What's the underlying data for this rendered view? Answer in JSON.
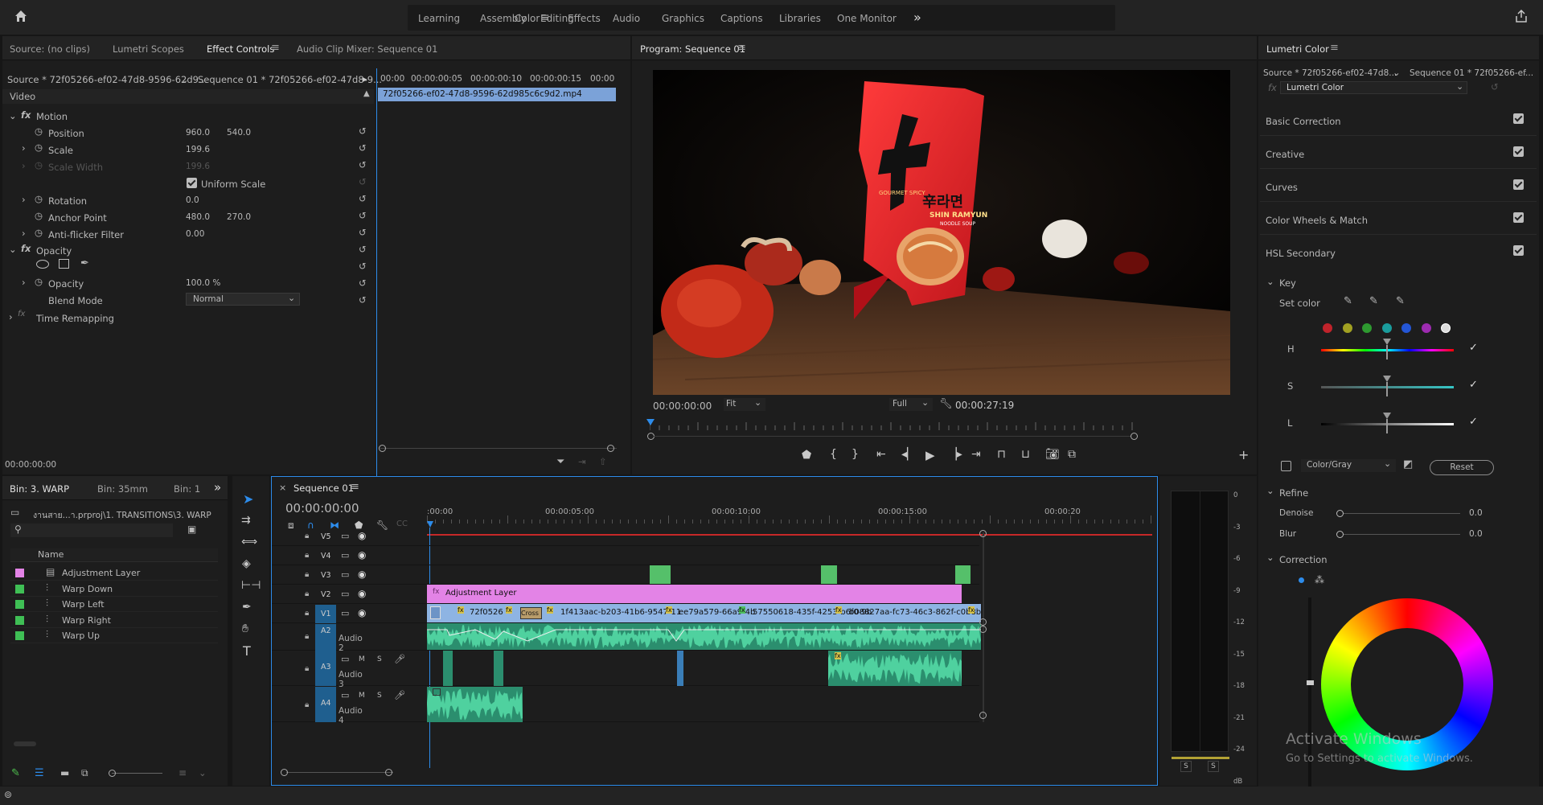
{
  "workspaces": {
    "items": [
      "Learning",
      "Assembly",
      "Editing",
      "Color",
      "Effects",
      "Audio",
      "Graphics",
      "Captions",
      "Libraries",
      "One Monitor"
    ],
    "active": "Color",
    "more": "»"
  },
  "ec": {
    "tabs": [
      "Source: (no clips)",
      "Lumetri Scopes",
      "Effect Controls",
      "Audio Clip Mixer: Sequence 01"
    ],
    "source_sel": "Source * 72f05266-ef02-47d8-9596-62d9...",
    "seq_sel": "Sequence 01 * 72f05266-ef02-47d8-9...",
    "ruler": [
      "00:00",
      "00:00:00:05",
      "00:00:00:10",
      "00:00:00:15",
      "00:00"
    ],
    "clip": "72f05266-ef02-47d8-9596-62d985c6c9d2.mp4",
    "video": "Video",
    "motion": "Motion",
    "position": "Position",
    "pos_x": "960.0",
    "pos_y": "540.0",
    "scale": "Scale",
    "scale_v": "199.6",
    "scale_width": "Scale Width",
    "scale_width_v": "199.6",
    "uniform": "Uniform Scale",
    "rotation": "Rotation",
    "rotation_v": "0.0",
    "anchor": "Anchor Point",
    "anchor_x": "480.0",
    "anchor_y": "270.0",
    "antiflicker": "Anti-flicker Filter",
    "antiflicker_v": "0.00",
    "opacity": "Opacity",
    "opacity_v": "100.0 %",
    "blend": "Blend Mode",
    "blend_v": "Normal",
    "time_remap": "Time Remapping",
    "timecode": "00:00:00:00"
  },
  "program": {
    "title": "Program: Sequence 01",
    "timecode": "00:00:00:00",
    "fit": "Fit",
    "full": "Full",
    "duration": "00:00:27:19",
    "pack": {
      "brand_ko": "辛라면",
      "brand": "SHIN RAMYUN",
      "noodle": "NOODLE SOUP",
      "spicy": "GOURMET SPICY"
    }
  },
  "lumetri": {
    "title": "Lumetri Color",
    "source_sel": "Source * 72f05266-ef02-47d8...",
    "seq_sel": "Sequence 01 * 72f05266-ef...",
    "effect": "Lumetri Color",
    "sections": [
      "Basic Correction",
      "Creative",
      "Curves",
      "Color Wheels & Match",
      "HSL Secondary"
    ],
    "key": "Key",
    "set_color": "Set color",
    "swatches": [
      "#c0232b",
      "#a2a122",
      "#2e9a30",
      "#1a9c9c",
      "#2456d6",
      "#9d2bb0",
      "#dcdcdc"
    ],
    "h": "H",
    "s": "S",
    "l": "L",
    "color_gray": "Color/Gray",
    "reset": "Reset",
    "refine": "Refine",
    "denoise": "Denoise",
    "denoise_v": "0.0",
    "blur": "Blur",
    "blur_v": "0.0",
    "correction": "Correction",
    "watermark1": "Activate Windows",
    "watermark2": "Go to Settings to activate Windows."
  },
  "project": {
    "tabs": [
      "Bin: 3. WARP",
      "Bin: 35mm",
      "Bin: 1"
    ],
    "path": "งานสาย...า.prproj\\1. TRANSITIONS\\3. WARP",
    "name_col": "Name",
    "items": [
      {
        "name": "Adjustment Layer",
        "color": "#e383e6"
      },
      {
        "name": "Warp Down",
        "color": "#3fbf55"
      },
      {
        "name": "Warp Left",
        "color": "#3fbf55"
      },
      {
        "name": "Warp Right",
        "color": "#3fbf55"
      },
      {
        "name": "Warp Up",
        "color": "#3fbf55"
      }
    ]
  },
  "timeline": {
    "title": "Sequence 01",
    "timecode": "00:00:00:00",
    "ruler": [
      ":00:00",
      "00:00:05:00",
      "00:00:10:00",
      "00:00:15:00",
      "00:00:20"
    ],
    "tracks": {
      "v5": "V5",
      "v4": "V4",
      "v3": "V3",
      "v2": "V2",
      "v1": "V1",
      "a2": "A2",
      "a3": "A3",
      "a4": "A4"
    },
    "audio2": "Audio 2",
    "audio3": "Audio 3",
    "audio4": "Audio 4",
    "m": "M",
    "s": "S",
    "adj": "Adjustment Layer",
    "clips": [
      "72f0526",
      "Cross",
      "1f413aac-b203-41b6-9547-11",
      "ee79a579-66a9-4b",
      "57550618-435f-4253-b6f0-9b",
      "b08827aa-fc73-46c3-862f-c0b8bbd4c639"
    ]
  },
  "meter": {
    "scale": [
      "0",
      "-3",
      "-6",
      "-9",
      "-12",
      "-15",
      "-18",
      "-21",
      "-24",
      "dB"
    ],
    "solo": [
      "S",
      "S"
    ]
  }
}
